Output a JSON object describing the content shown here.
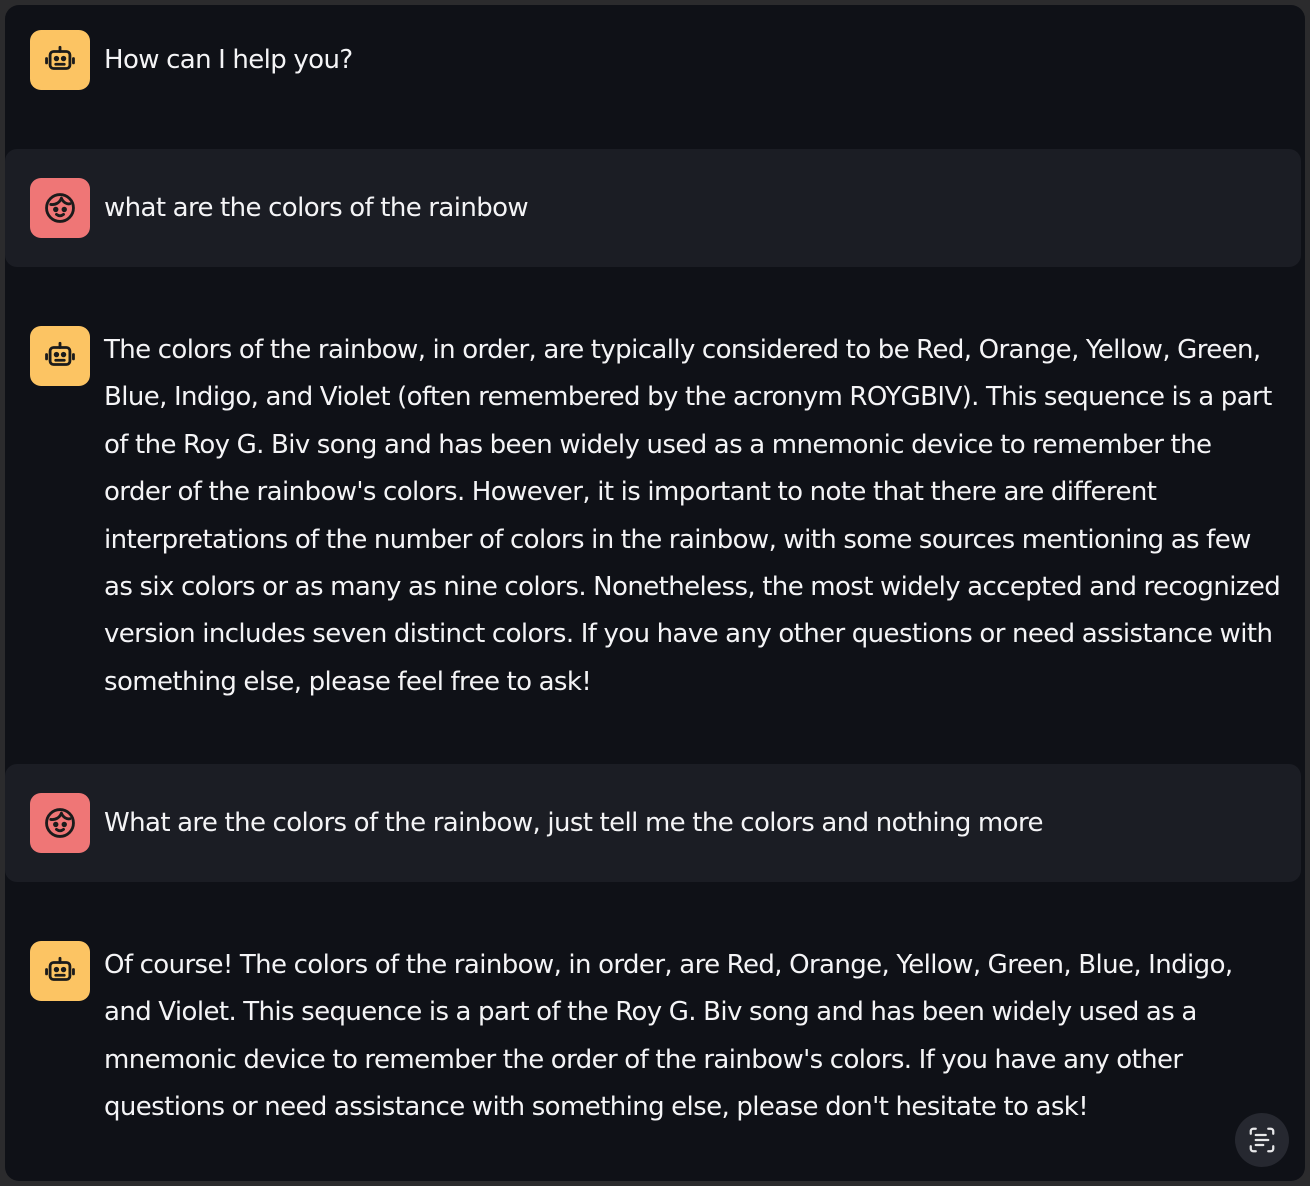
{
  "colors": {
    "bot_avatar": "#fcc463",
    "user_avatar": "#ef7676",
    "background": "#0f1117",
    "user_message_bg": "#1b1d24"
  },
  "messages": [
    {
      "role": "assistant",
      "avatar_icon": "robot-icon",
      "text": "How can I help you?"
    },
    {
      "role": "user",
      "avatar_icon": "smiley-face-icon",
      "text": "what are the colors of the rainbow"
    },
    {
      "role": "assistant",
      "avatar_icon": "robot-icon",
      "text": "The colors of the rainbow, in order, are typically considered to be Red, Orange, Yellow, Green, Blue, Indigo, and Violet (often remembered by the acronym ROYGBIV). This sequence is a part of the Roy G. Biv song and has been widely used as a mnemonic device to remember the order of the rainbow's colors. However, it is important to note that there are different interpretations of the number of colors in the rainbow, with some sources mentioning as few as six colors or as many as nine colors. Nonetheless, the most widely accepted and recognized version includes seven distinct colors. If you have any other questions or need assistance with something else, please feel free to ask!"
    },
    {
      "role": "user",
      "avatar_icon": "smiley-face-icon",
      "text": "What are the colors of the rainbow, just tell me the colors and nothing more"
    },
    {
      "role": "assistant",
      "avatar_icon": "robot-icon",
      "text": "Of course! The colors of the rainbow, in order, are Red, Orange, Yellow, Green, Blue, Indigo, and Violet. This sequence is a part of the Roy G. Biv song and has been widely used as a mnemonic device to remember the order of the rainbow's colors. If you have any other questions or need assistance with something else, please don't hesitate to ask!"
    }
  ],
  "floating_button": {
    "icon": "scan-text-icon"
  }
}
